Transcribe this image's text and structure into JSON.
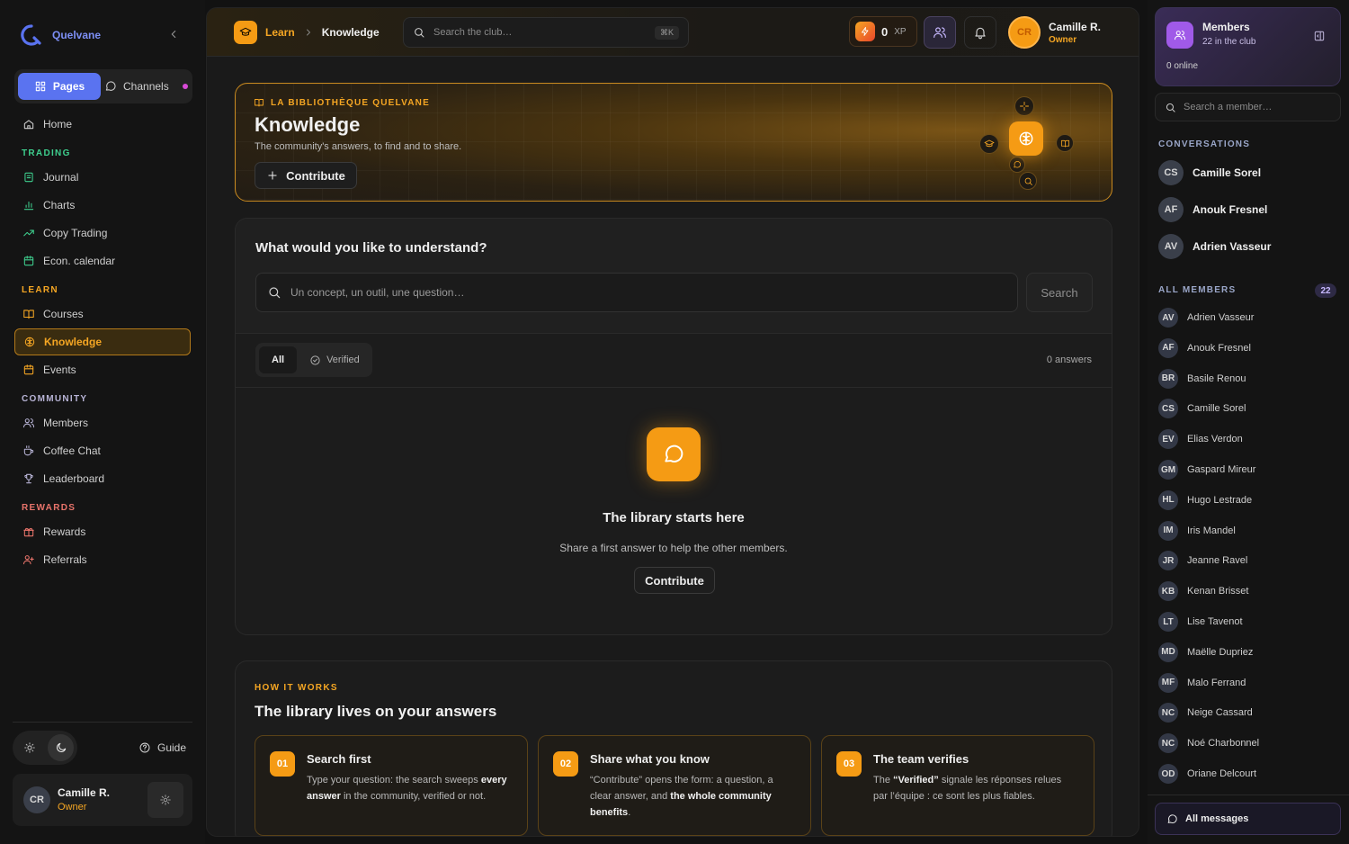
{
  "brand": {
    "name": "Quelvane"
  },
  "sidebar": {
    "switch": {
      "pages": "Pages",
      "channels": "Channels"
    },
    "home": "Home",
    "sections": [
      {
        "title": "TRADING",
        "color": "#3ecf8e",
        "items": [
          "Journal",
          "Charts",
          "Copy Trading",
          "Econ. calendar"
        ]
      },
      {
        "title": "LEARN",
        "color": "#f5a623",
        "items": [
          "Courses",
          "Knowledge",
          "Events"
        ]
      },
      {
        "title": "COMMUNITY",
        "color": "#b8b4d6",
        "items": [
          "Members",
          "Coffee Chat",
          "Leaderboard"
        ]
      },
      {
        "title": "REWARDS",
        "color": "#e9746b",
        "items": [
          "Rewards",
          "Referrals"
        ]
      }
    ],
    "active_item": "Knowledge",
    "guide": "Guide",
    "user": {
      "initials": "CR",
      "name": "Camille R.",
      "role": "Owner"
    }
  },
  "topbar": {
    "breadcrumb": {
      "section": "Learn",
      "page": "Knowledge"
    },
    "search_placeholder": "Search the club…",
    "shortcut": "⌘K",
    "xp_value": "0",
    "xp_label": "XP",
    "user": {
      "initials": "CR",
      "name": "Camille R.",
      "role": "Owner"
    }
  },
  "hero": {
    "kicker": "LA BIBLIOTHÈQUE QUELVANE",
    "title": "Knowledge",
    "subtitle": "The community's answers, to find and to share.",
    "button": "Contribute"
  },
  "question": {
    "title": "What would you like to understand?",
    "placeholder": "Un concept, un outil, une question…",
    "search_button": "Search",
    "filters": {
      "all": "All",
      "verified": "Verified"
    },
    "answers_count": "0 answers",
    "empty": {
      "title": "The library starts here",
      "subtitle": "Share a first answer to help the other members.",
      "button": "Contribute"
    }
  },
  "how": {
    "kicker": "HOW IT WORKS",
    "title": "The library lives on your answers",
    "steps": [
      {
        "num": "01",
        "title": "Search first",
        "text_html": "Type your question: the search sweeps <b>every answer</b> in the community, verified or not."
      },
      {
        "num": "02",
        "title": "Share what you know",
        "text_html": "“Contribute” opens the form: a question, a clear answer, and <b>the whole community benefits</b>."
      },
      {
        "num": "03",
        "title": "The team verifies",
        "text_html": "The <b>“Verified”</b> signale les réponses relues par l’équipe : ce sont les plus fiables."
      }
    ]
  },
  "members_panel": {
    "title": "Members",
    "subtitle": "22 in the club",
    "online": "0 online",
    "search_placeholder": "Search a member…",
    "conversations_title": "CONVERSATIONS",
    "conversations": [
      {
        "initials": "CS",
        "name": "Camille Sorel"
      },
      {
        "initials": "AF",
        "name": "Anouk Fresnel"
      },
      {
        "initials": "AV",
        "name": "Adrien Vasseur"
      }
    ],
    "all_members_title": "ALL MEMBERS",
    "all_members_count": "22",
    "members": [
      {
        "initials": "AV",
        "name": "Adrien Vasseur"
      },
      {
        "initials": "AF",
        "name": "Anouk Fresnel"
      },
      {
        "initials": "BR",
        "name": "Basile Renou"
      },
      {
        "initials": "CS",
        "name": "Camille Sorel"
      },
      {
        "initials": "EV",
        "name": "Elias Verdon"
      },
      {
        "initials": "GM",
        "name": "Gaspard Mireur"
      },
      {
        "initials": "HL",
        "name": "Hugo Lestrade"
      },
      {
        "initials": "IM",
        "name": "Iris Mandel"
      },
      {
        "initials": "JR",
        "name": "Jeanne Ravel"
      },
      {
        "initials": "KB",
        "name": "Kenan Brisset"
      },
      {
        "initials": "LT",
        "name": "Lise Tavenot"
      },
      {
        "initials": "MD",
        "name": "Maëlle Dupriez"
      },
      {
        "initials": "MF",
        "name": "Malo Ferrand"
      },
      {
        "initials": "NC",
        "name": "Neige Cassard"
      },
      {
        "initials": "NC",
        "name": "Noé Charbonnel"
      },
      {
        "initials": "OD",
        "name": "Oriane Delcourt"
      }
    ],
    "all_messages": "All messages"
  },
  "colors": {
    "accent": "#f59b14",
    "brand": "#5a73f0",
    "members_accent": "#a05ae8"
  }
}
